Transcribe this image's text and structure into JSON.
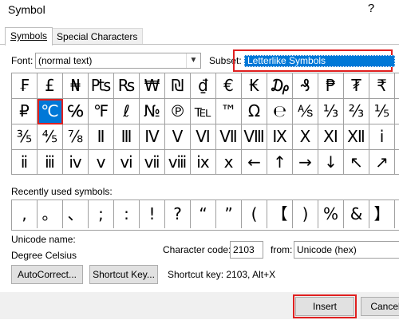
{
  "window": {
    "title": "Symbol",
    "help": "?"
  },
  "tabs": [
    "Symbols",
    "Special Characters"
  ],
  "font": {
    "label": "Font:",
    "value": "(normal text)"
  },
  "subset": {
    "label": "Subset:",
    "value": "Letterlike Symbols"
  },
  "grid_rows": [
    [
      "₣",
      "£",
      "₦",
      "₧",
      "₨",
      "₩",
      "₪",
      "₫",
      "€",
      "₭",
      "₯",
      "₰",
      "₱",
      "₮",
      "₹",
      "₺"
    ],
    [
      "₽",
      "℃",
      "℅",
      "℉",
      "ℓ",
      "№",
      "℗",
      "℡",
      "™",
      "Ω",
      "℮",
      "⅍",
      "⅓",
      "⅔",
      "⅕",
      "⅖"
    ],
    [
      "⅗",
      "⅘",
      "⅞",
      "Ⅱ",
      "Ⅲ",
      "Ⅳ",
      "Ⅴ",
      "Ⅵ",
      "Ⅶ",
      "Ⅷ",
      "Ⅸ",
      "Ⅹ",
      "Ⅺ",
      "Ⅻ",
      "ⅰ",
      "ⅱ"
    ],
    [
      "ⅱ",
      "ⅲ",
      "ⅳ",
      "ⅴ",
      "ⅵ",
      "ⅶ",
      "ⅷ",
      "ⅸ",
      "ⅹ",
      "←",
      "↑",
      "→",
      "↓",
      "↖",
      "↗",
      "↘"
    ]
  ],
  "selected_symbol": "℃",
  "recently_used": {
    "label": "Recently used symbols:",
    "items": [
      ",",
      "。",
      "、",
      ";",
      ":",
      "!",
      "?",
      "“",
      "”",
      "(",
      "【",
      ")",
      "%",
      "&",
      "】",
      "※"
    ]
  },
  "unicode_name": {
    "label": "Unicode name:",
    "value": "Degree Celsius"
  },
  "character_code": {
    "label": "Character code:",
    "value": "2103"
  },
  "from": {
    "label": "from:",
    "value": "Unicode (hex)"
  },
  "buttons": {
    "autocorrect": "AutoCorrect...",
    "shortcut_key": "Shortcut Key...",
    "insert": "Insert",
    "cancel": "Cancel"
  },
  "shortcut_info": "Shortcut key: 2103, Alt+X"
}
